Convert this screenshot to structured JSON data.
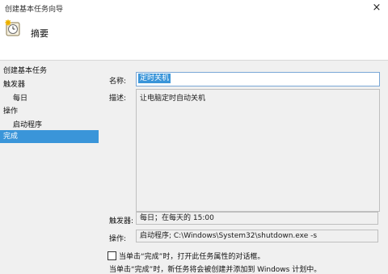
{
  "window": {
    "title": "创建基本任务向导",
    "close_icon": "×"
  },
  "header": {
    "title": "摘要"
  },
  "sidebar": {
    "items": [
      {
        "label": "创建基本任务"
      },
      {
        "label": "触发器"
      },
      {
        "label": "每日"
      },
      {
        "label": "操作"
      },
      {
        "label": "启动程序"
      },
      {
        "label": "完成"
      }
    ]
  },
  "form": {
    "name_label": "名称:",
    "name_value": "定时关机",
    "description_label": "描述:",
    "description_value": "让电脑定时自动关机",
    "trigger_label": "触发器:",
    "trigger_value": "每日；在每天的 15:00",
    "action_label": "操作:",
    "action_value": "启动程序; C:\\Windows\\System32\\shutdown.exe -s"
  },
  "footer": {
    "checkbox_label": "当单击“完成”时，打开此任务属性的对话框。",
    "info_text": "当单击“完成”时，新任务将会被创建并添加到 Windows 计划中。"
  },
  "colors": {
    "selection": "#3a95d9"
  }
}
